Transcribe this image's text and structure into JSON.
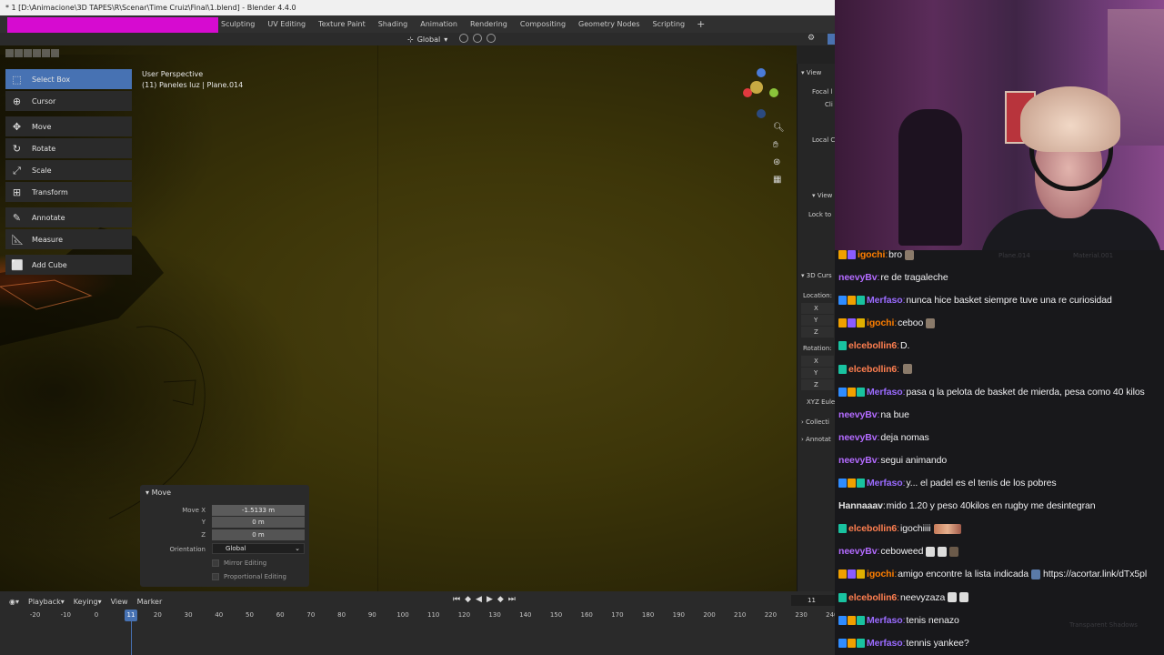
{
  "blender": {
    "window_title": "* 1 [D:\\Animacione\\3D TAPES\\R\\Scenar\\Time Cruiz\\Final\\1.blend] - Blender 4.4.0",
    "workspace_tabs": [
      "Sculpting",
      "UV Editing",
      "Texture Paint",
      "Shading",
      "Animation",
      "Rendering",
      "Compositing",
      "Geometry Nodes",
      "Scripting"
    ],
    "add_workspace": "+",
    "header": {
      "transform_orientation": "Global"
    },
    "viewport": {
      "perspective": "User Perspective",
      "object_info": "(11) Paneles luz | Plane.014"
    },
    "tools": [
      {
        "label": "Select Box",
        "icon": "select-box-icon",
        "active": true
      },
      {
        "label": "Cursor",
        "icon": "cursor-icon",
        "active": false
      },
      {
        "label": "Move",
        "icon": "move-icon",
        "active": false
      },
      {
        "label": "Rotate",
        "icon": "rotate-icon",
        "active": false
      },
      {
        "label": "Scale",
        "icon": "scale-icon",
        "active": false
      },
      {
        "label": "Transform",
        "icon": "transform-icon",
        "active": false
      },
      {
        "label": "Annotate",
        "icon": "annotate-icon",
        "active": false
      },
      {
        "label": "Measure",
        "icon": "measure-icon",
        "active": false
      },
      {
        "label": "Add Cube",
        "icon": "add-cube-icon",
        "active": false
      }
    ],
    "npanel": {
      "view_header": "View",
      "focal": "Focal l",
      "clip": "Cli",
      "local": "Local C",
      "view2": "View",
      "lock": "Lock to",
      "cursor_header": "3D Curs",
      "location": "Location:",
      "rotation": "Rotation:",
      "x": "X",
      "y": "Y",
      "z": "Z",
      "euler": "XYZ Eule",
      "collection": "Collecti",
      "annotations": "Annotat"
    },
    "redo_panel": {
      "title": "Move",
      "move_x_label": "Move X",
      "move_x": "-1.5133 m",
      "y_label": "Y",
      "y": "0 m",
      "z_label": "Z",
      "z": "0 m",
      "orientation_label": "Orientation",
      "orientation": "Global",
      "mirror": "Mirror Editing",
      "proportional": "Proportional Editing"
    },
    "timeline": {
      "menus": [
        "Playback",
        "Keying",
        "View",
        "Marker"
      ],
      "current_frame": "11",
      "frame_field": "11",
      "ticks": [
        "-20",
        "-10",
        "0",
        "20",
        "30",
        "40",
        "50",
        "60",
        "70",
        "80",
        "90",
        "100",
        "110",
        "120",
        "130",
        "140",
        "150",
        "160",
        "170",
        "180",
        "190",
        "200",
        "210",
        "220",
        "230",
        "240"
      ]
    }
  },
  "chat": {
    "background_ghost_text": [
      "Plane.014",
      "Material.001",
      "Transparent Shadows"
    ],
    "messages": [
      {
        "user": "igochi",
        "color": "#ff7f00",
        "text": "bro",
        "badges": [
          "#f0a000",
          "#8a5cff"
        ],
        "emote": "small"
      },
      {
        "user": "neevyBv",
        "color": "#b36bff",
        "text": "re de tragaleche",
        "badges": []
      },
      {
        "user": "Merfaso",
        "color": "#9a6bff",
        "text": "nunca hice basket siempre tuve una re curiosidad",
        "badges": [
          "#2f8cff",
          "#f0a000",
          "#19c2a0"
        ]
      },
      {
        "user": "igochi",
        "color": "#ff7f00",
        "text": "ceboo",
        "badges": [
          "#f0a000",
          "#8a5cff",
          "#e0b000"
        ],
        "emote": "small"
      },
      {
        "user": "elcebollin6",
        "color": "#ff7f50",
        "text": "D.",
        "badges": [
          "#19c2a0"
        ]
      },
      {
        "user": "elcebollin6",
        "color": "#ff7f50",
        "text": "",
        "badges": [
          "#19c2a0"
        ],
        "emote": "small"
      },
      {
        "user": "Merfaso",
        "color": "#9a6bff",
        "text": "pasa q la pelota de basket de mierda, pesa como 40 kilos",
        "badges": [
          "#2f8cff",
          "#f0a000",
          "#19c2a0"
        ]
      },
      {
        "user": "neevyBv",
        "color": "#b36bff",
        "text": "na bue",
        "badges": []
      },
      {
        "user": "neevyBv",
        "color": "#b36bff",
        "text": "deja nomas",
        "badges": []
      },
      {
        "user": "neevyBv",
        "color": "#b36bff",
        "text": "segui animando",
        "badges": []
      },
      {
        "user": "Merfaso",
        "color": "#9a6bff",
        "text": "y... el padel es el tenis de los pobres",
        "badges": [
          "#2f8cff",
          "#f0a000",
          "#19c2a0"
        ]
      },
      {
        "user": "Hannaaav",
        "color": "#e4e4e4",
        "text": "mido 1.20 y peso 40kilos en rugby me desintegran",
        "badges": []
      },
      {
        "user": "elcebollin6",
        "color": "#ff7f50",
        "text": "igochiiii",
        "badges": [
          "#19c2a0"
        ],
        "emote": "wide"
      },
      {
        "user": "neevyBv",
        "color": "#b36bff",
        "text": "ceboweed",
        "badges": [],
        "emote": "triple"
      },
      {
        "user": "igochi",
        "color": "#ff7f00",
        "text": "amigo encontre la lista indicada",
        "badges": [
          "#f0a000",
          "#8a5cff",
          "#e0b000"
        ],
        "link": "https://acortar.link/dTx5pl"
      },
      {
        "user": "elcebollin6",
        "color": "#ff7f50",
        "text": "neevyzaza",
        "badges": [
          "#19c2a0"
        ],
        "emote": "double"
      },
      {
        "user": "Merfaso",
        "color": "#9a6bff",
        "text": "tenis nenazo",
        "badges": [
          "#2f8cff",
          "#f0a000",
          "#19c2a0"
        ]
      },
      {
        "user": "Merfaso",
        "color": "#9a6bff",
        "text": "tennis yankee?",
        "badges": [
          "#2f8cff",
          "#f0a000",
          "#19c2a0"
        ]
      }
    ]
  },
  "colors": {
    "blender_accent": "#4772b3",
    "chat_bg": "#18181b",
    "stream_overlay_magenta": "#d60bd0"
  }
}
